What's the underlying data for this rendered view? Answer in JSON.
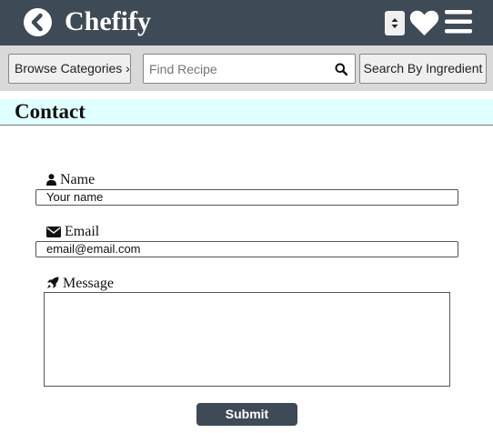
{
  "header": {
    "title": "Chefify",
    "back_icon": "chevron-left-circle-icon",
    "sort_icon": "sort-arrows-icon",
    "favorites_icon": "heart-icon",
    "menu_icon": "hamburger-menu-icon",
    "background_color": "#3e4a55"
  },
  "toolbar": {
    "browse_label": "Browse Categories ›",
    "search": {
      "placeholder": "Find Recipe",
      "value": "",
      "icon": "search-icon"
    },
    "ingredient_label": "Search By Ingredient"
  },
  "section": {
    "title": "Contact",
    "background_color": "#e0ffff"
  },
  "form": {
    "name": {
      "label": "Name",
      "icon": "user-icon",
      "value": "Your name"
    },
    "email": {
      "label": "Email",
      "icon": "envelope-icon",
      "value": "email@email.com"
    },
    "message": {
      "label": "Message",
      "icon": "rocket-icon",
      "value": ""
    },
    "submit_label": "Submit"
  }
}
